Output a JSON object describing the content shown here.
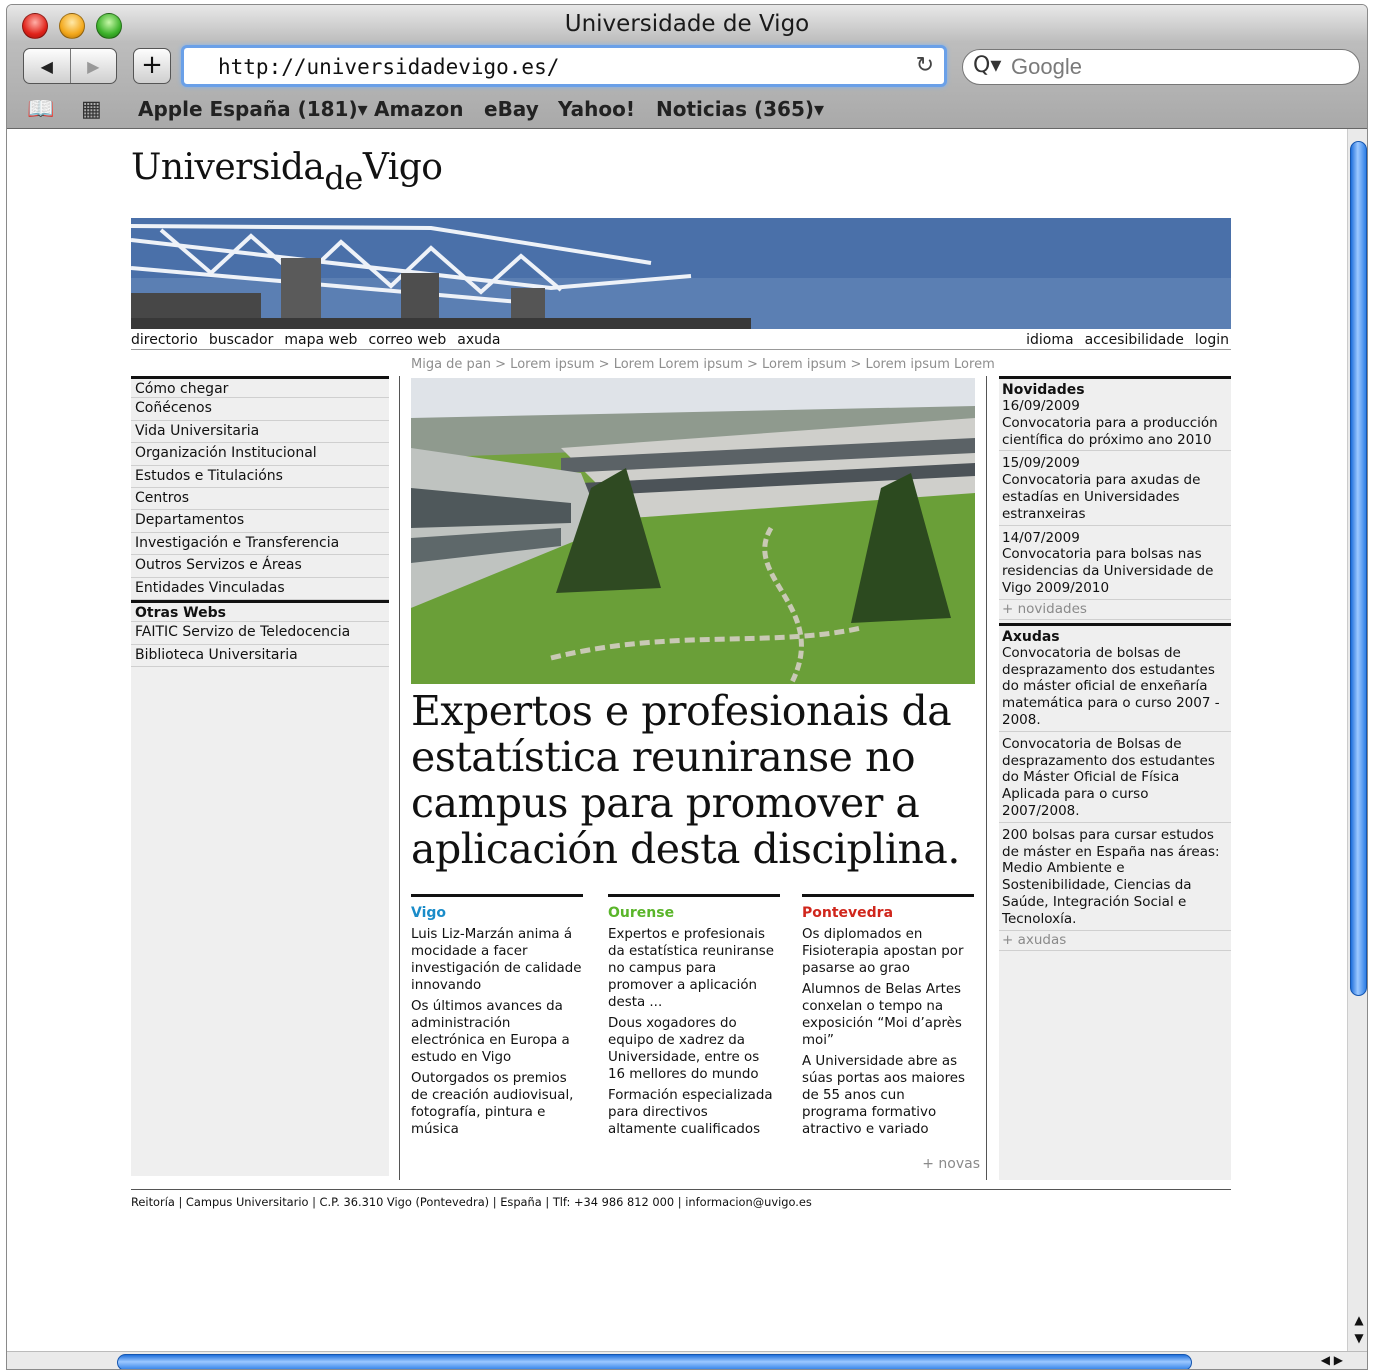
{
  "browser": {
    "window_title": "Universidade de Vigo",
    "url": "http://universidadevigo.es/",
    "search_placeholder": "Google",
    "back_glyph": "◀",
    "forward_glyph": "▶",
    "add_glyph": "+",
    "reload_glyph": "↻",
    "search_glyph": "Q▾",
    "bookmarks": [
      "Apple España (181)▾",
      "Amazon",
      "eBay",
      "Yahoo!",
      "Noticias (365)▾"
    ],
    "bookmark_icons": {
      "book": "📖",
      "grid": "▦"
    }
  },
  "site": {
    "logo": {
      "before": "Universida",
      "de": "de",
      "after": "Vigo"
    },
    "topnav_left": [
      "directorio",
      "buscador",
      "mapa web",
      "correo web",
      "axuda"
    ],
    "topnav_right": [
      "idioma",
      "accesibilidade",
      "login"
    ],
    "breadcrumb": "Miga de pan > Lorem ipsum > Lorem Lorem ipsum > Lorem ipsum > Lorem ipsum Lorem",
    "left_menu": [
      "Cómo chegar",
      "Coñécenos",
      "Vida Universitaria",
      "Organización Institucional",
      "Estudos e Titulacións",
      "Centros",
      "Departamentos",
      "Investigación e Transferencia",
      "Outros Servizos e Áreas",
      "Entidades Vinculadas"
    ],
    "other_webs_heading": "Otras Webs",
    "other_webs": [
      "FAITIC Servizo de Teledocencia",
      "Biblioteca Universitaria"
    ],
    "headline": "Expertos e profesionais da estatística reuniranse no campus para promover a aplicación desta disciplina.",
    "campuses": [
      {
        "name": "Vigo",
        "color": "#1a8cc9",
        "items": [
          "Luis Liz-Marzán anima á mocidade a facer investigación de calidade innovando",
          "Os últimos avances da administración electrónica en Europa a estudo en Vigo",
          "Outorgados os premios de creación audiovisual, fotografía, pintura e música"
        ]
      },
      {
        "name": "Ourense",
        "color": "#5ab52a",
        "items": [
          "Expertos e profesionais da estatística reuniranse no campus para promover a aplicación desta ...",
          "Dous xogadores do equipo de xadrez da Universidade, entre os 16 mellores do mundo",
          "Formación especializada para directivos altamente cualificados"
        ]
      },
      {
        "name": "Pontevedra",
        "color": "#d0261c",
        "items": [
          "Os diplomados en Fisioterapia apostan por pasarse ao grao",
          "Alumnos de Belas Artes conxelan o tempo na exposición “Moi d’après moi”",
          "A Universidade abre as súas portas aos maiores de 55 anos cun programa formativo atractivo e variado"
        ]
      }
    ],
    "more_news": "+ novas",
    "novidades_heading": "Novidades",
    "novidades": [
      {
        "date": "16/09/2009",
        "text": "Convocatoria para a producción científica do próximo ano 2010"
      },
      {
        "date": "15/09/2009",
        "text": "Convocatoria para axudas de estadías en Universidades estranxeiras"
      },
      {
        "date": "14/07/2009",
        "text": "Convocatoria para bolsas nas residencias da Universidade de Vigo 2009/2010"
      }
    ],
    "more_novidades": "+ novidades",
    "axudas_heading": "Axudas",
    "axudas": [
      "Convocatoria de bolsas de desprazamento dos estudantes do máster oficial de enxeñaría matemática para o curso 2007 - 2008.",
      "Convocatoria de Bolsas de desprazamento dos estudantes do Máster Oficial de Física Aplicada para o curso 2007/2008.",
      "200 bolsas para cursar estudos de máster en España nas áreas: Medio Ambiente e Sostenibilidade, Ciencias da Saúde, Integración Social e Tecnoloxía."
    ],
    "more_axudas": "+ axudas",
    "footer": "Reitoría | Campus Universitario | C.P. 36.310 Vigo (Pontevedra) | España | Tlf: +34 986 812 000 | informacion@uvigo.es"
  }
}
